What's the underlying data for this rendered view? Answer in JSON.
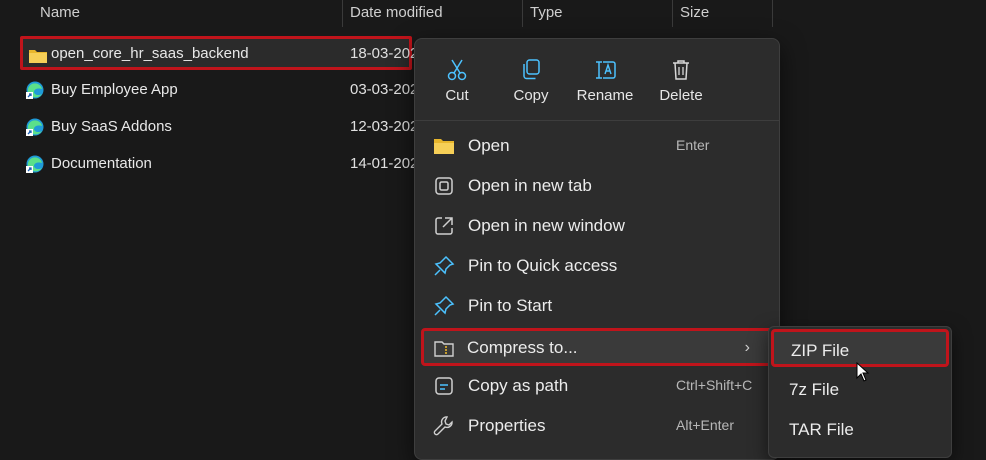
{
  "columns": {
    "name": "Name",
    "date": "Date modified",
    "type": "Type",
    "size": "Size"
  },
  "files": [
    {
      "name": "open_core_hr_saas_backend",
      "date": "18-03-202",
      "icon": "folder-icon",
      "selected": true
    },
    {
      "name": "Buy Employee App",
      "date": "03-03-202",
      "icon": "edge-shortcut-icon"
    },
    {
      "name": "Buy SaaS Addons",
      "date": "12-03-202",
      "icon": "edge-shortcut-icon"
    },
    {
      "name": "Documentation",
      "date": "14-01-202",
      "icon": "edge-shortcut-icon"
    }
  ],
  "context_menu": {
    "quick_actions": [
      {
        "label": "Cut",
        "icon": "scissors-icon"
      },
      {
        "label": "Copy",
        "icon": "copy-icon"
      },
      {
        "label": "Rename",
        "icon": "rename-icon"
      },
      {
        "label": "Delete",
        "icon": "trash-icon"
      }
    ],
    "items": [
      {
        "label": "Open",
        "shortcut": "Enter",
        "icon": "folder-icon"
      },
      {
        "label": "Open in new tab",
        "shortcut": "",
        "icon": "new-tab-icon"
      },
      {
        "label": "Open in new window",
        "shortcut": "",
        "icon": "new-window-icon"
      },
      {
        "label": "Pin to Quick access",
        "shortcut": "",
        "icon": "pin-icon"
      },
      {
        "label": "Pin to Start",
        "shortcut": "",
        "icon": "pin-icon"
      },
      {
        "label": "Compress to...",
        "shortcut": "",
        "icon": "compress-icon",
        "has_submenu": true,
        "submenu_arrow": "›"
      },
      {
        "label": "Copy as path",
        "shortcut": "Ctrl+Shift+C",
        "icon": "copy-path-icon"
      },
      {
        "label": "Properties",
        "shortcut": "Alt+Enter",
        "icon": "wrench-icon"
      }
    ]
  },
  "compress_submenu": {
    "items": [
      {
        "label": "ZIP File"
      },
      {
        "label": "7z File"
      },
      {
        "label": "TAR File"
      }
    ]
  },
  "colors": {
    "background": "#191919",
    "menu": "#2c2c2c",
    "accent": "#4cc2ff",
    "highlight": "#c0141b",
    "folder": "#f0c447"
  }
}
